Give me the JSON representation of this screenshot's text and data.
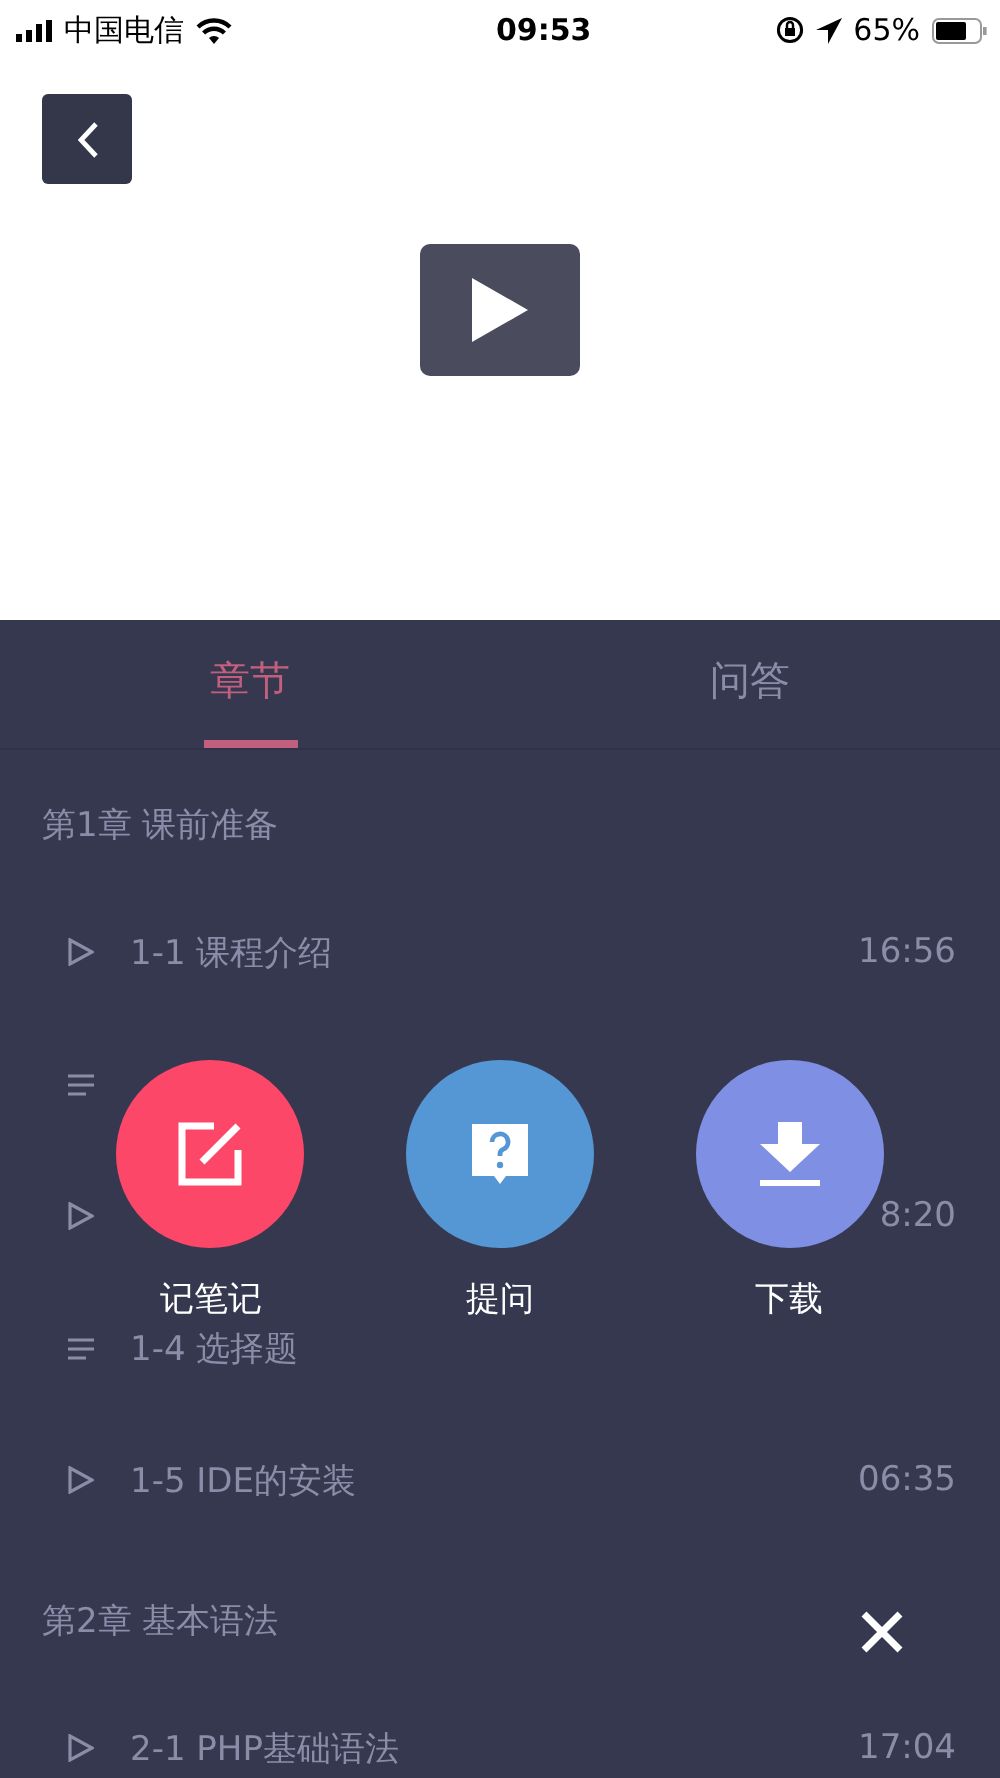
{
  "status_bar": {
    "carrier": "中国电信",
    "time": "09:53",
    "battery": "65%"
  },
  "tabs": [
    {
      "label": "章节",
      "selected": true
    },
    {
      "label": "问答",
      "selected": false
    }
  ],
  "chapters": [
    {
      "title": "第1章 课前准备",
      "lessons": [
        {
          "kind": "video",
          "title": "1-1 课程介绍",
          "duration": "16:56"
        },
        {
          "kind": "quiz"
        },
        {
          "kind": "video",
          "duration": "8:20"
        },
        {
          "kind": "quiz",
          "title": "1-4 选择题"
        },
        {
          "kind": "video",
          "title": "1-5 IDE的安装",
          "duration": "06:35"
        }
      ]
    },
    {
      "title": "第2章 基本语法",
      "lessons": [
        {
          "kind": "video",
          "title": "2-1 PHP基础语法",
          "duration": "17:04"
        }
      ]
    }
  ],
  "actions": [
    {
      "kind": "note",
      "label": "记笔记",
      "color": "#fd4769"
    },
    {
      "kind": "ask",
      "label": "提问",
      "color": "#5596d4"
    },
    {
      "kind": "download",
      "label": "下载",
      "color": "#7f8fe3"
    }
  ]
}
